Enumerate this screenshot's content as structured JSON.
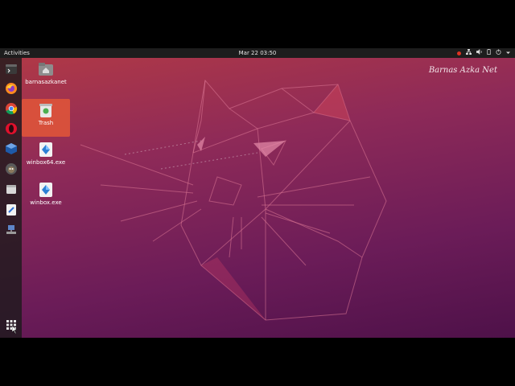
{
  "topbar": {
    "activities": "Activities",
    "clock": "Mar 22  03:50"
  },
  "desktop_icons": [
    {
      "label": "barnasazkanet",
      "icon": "folder-home-icon"
    },
    {
      "label": "Trash",
      "icon": "trash-icon"
    },
    {
      "label": "winbox64.exe",
      "icon": "exe-icon"
    },
    {
      "label": "winbox.exe",
      "icon": "exe-icon"
    }
  ],
  "dock": [
    "terminal-icon",
    "firefox-icon",
    "chrome-icon",
    "opera-icon",
    "virtualbox-icon",
    "gimp-icon",
    "files-icon",
    "text-editor-icon",
    "network-icon",
    "show-apps-icon"
  ],
  "watermark": "Barnas Azka Net",
  "colors": {
    "wallpaper_top": "#b33a45",
    "wallpaper_bottom": "#4e1149",
    "selection": "#e25638"
  }
}
